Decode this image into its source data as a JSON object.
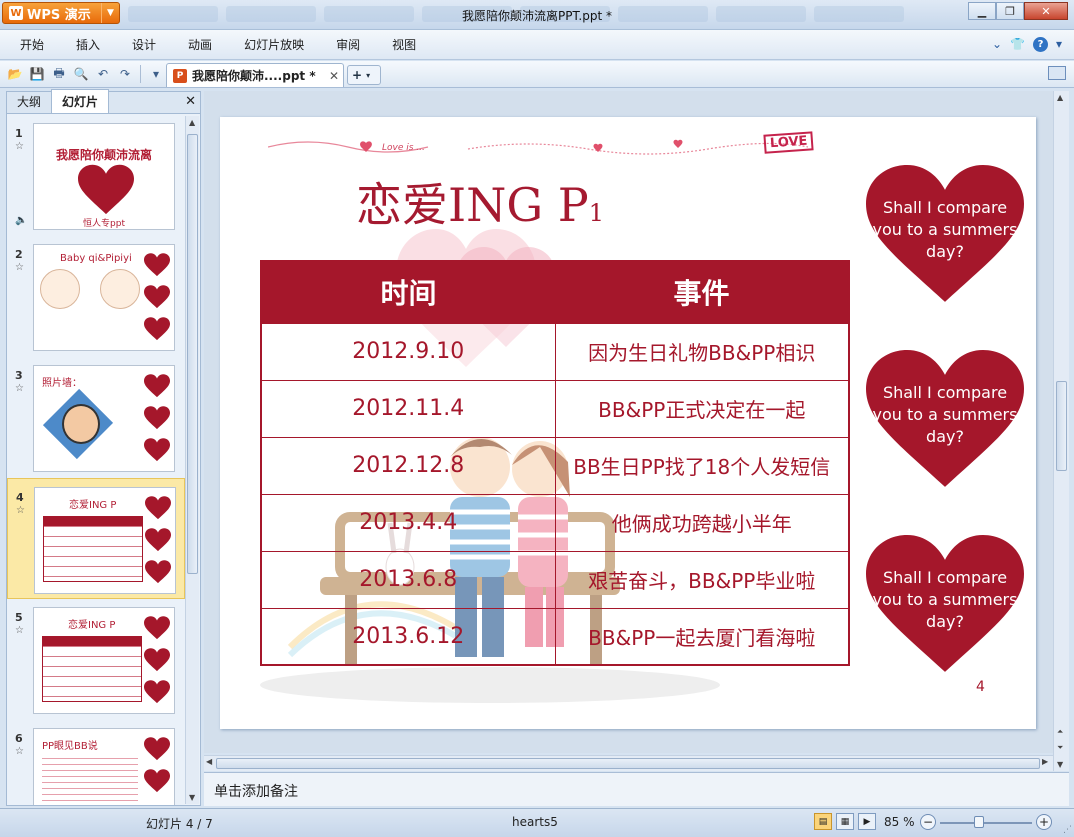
{
  "app": {
    "title": "我愿陪你颠沛流离PPT.ppt *",
    "brand": "WPS 演示",
    "accent": "#a5172b"
  },
  "menu": [
    "开始",
    "插入",
    "设计",
    "动画",
    "幻灯片放映",
    "审阅",
    "视图"
  ],
  "document_tab": {
    "label": "我愿陪你颠沛....ppt *",
    "close": "✕",
    "new": "+"
  },
  "panel": {
    "tabs": [
      "大纲",
      "幻灯片"
    ],
    "active_tab": "幻灯片",
    "close": "✕",
    "thumbnails": [
      {
        "num": "1",
        "title": "我愿陪你颠沛流离",
        "subtitle": "恒人专ppt"
      },
      {
        "num": "2",
        "title": "Baby qi&Pipiyi"
      },
      {
        "num": "3",
        "title": "照片墙："
      },
      {
        "num": "4",
        "title": "恋爱ING  P",
        "selected": true
      },
      {
        "num": "5",
        "title": "恋爱ING  P"
      },
      {
        "num": "6",
        "title": "PP眼见BB说"
      }
    ]
  },
  "slide": {
    "title_main": "恋爱ING  P",
    "title_sub": "1",
    "banner_text": "Love is ...",
    "love_sign": "LOVE",
    "table": {
      "headers": [
        "时间",
        "事件"
      ],
      "rows": [
        {
          "date": "2012.9.10",
          "event": "因为生日礼物BB&PP相识"
        },
        {
          "date": "2012.11.4",
          "event": "BB&PP正式决定在一起"
        },
        {
          "date": "2012.12.8",
          "event": "BB生日PP找了18个人发短信"
        },
        {
          "date": "2013.4.4",
          "event": "他俩成功跨越小半年"
        },
        {
          "date": "2013.6.8",
          "event": "艰苦奋斗，BB&PP毕业啦"
        },
        {
          "date": "2013.6.12",
          "event": "BB&PP一起去厦门看海啦"
        }
      ]
    },
    "hearts": [
      {
        "text": "Shall I compare you to a summers day?"
      },
      {
        "text": "Shall I compare you to a summers day?"
      },
      {
        "text": "Shall I compare you to a summers day?"
      }
    ],
    "page_number": "4"
  },
  "notes": {
    "placeholder": "单击添加备注"
  },
  "status": {
    "slide_counter": "幻灯片 4 / 7",
    "theme": "hearts5",
    "zoom": "85 %",
    "zoom_level": 0.42
  }
}
